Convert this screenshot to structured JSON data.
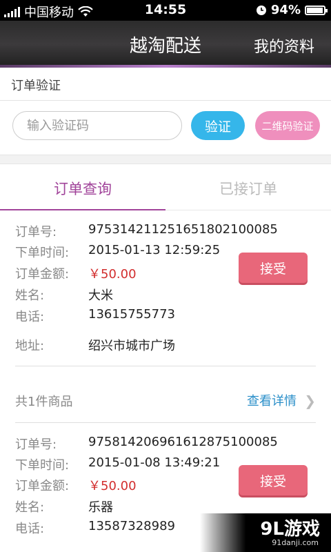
{
  "status_bar": {
    "carrier": "中国移动",
    "time": "14:55",
    "battery": "94%",
    "battery_level": 0.94
  },
  "header": {
    "title": "越淘配送",
    "right_link": "我的资料"
  },
  "verify": {
    "section_label": "订单验证",
    "input_placeholder": "输入验证码",
    "verify_button": "验证",
    "qr_button": "二维码验证"
  },
  "tabs": {
    "active": "订单查询",
    "inactive": "已接订单"
  },
  "labels": {
    "order_no": "订单号:",
    "order_time": "下单时间:",
    "amount": "订单金额:",
    "name": "姓名:",
    "phone": "电话:",
    "address": "地址:"
  },
  "orders": [
    {
      "order_no": "97531421125165180210​0085",
      "order_time": "2015-01-13 12:59:25",
      "amount": "￥50.00",
      "name": "大米",
      "phone": "13615755773",
      "address": "绍兴市城市广场",
      "accept_label": "接受"
    },
    {
      "order_no": "97581420696161287510​0085",
      "order_time": "2015-01-08 13:49:21",
      "amount": "￥50.00",
      "name": "乐器",
      "phone": "13587328989",
      "accept_label": "接受"
    }
  ],
  "summary": {
    "items_count": "共1件商品",
    "details_link": "查看详情"
  },
  "watermark": {
    "brand": "9L游戏",
    "site": "91danji.com"
  }
}
